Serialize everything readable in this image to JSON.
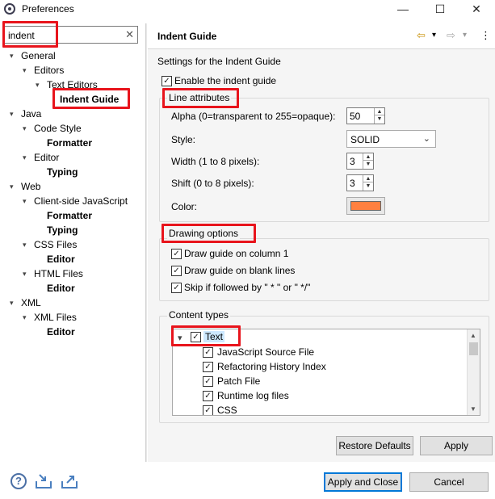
{
  "window": {
    "title": "Preferences",
    "min": "—",
    "max": "☐",
    "close": "✕"
  },
  "search": {
    "value": "indent",
    "clear": "✕"
  },
  "tree": [
    {
      "label": "General",
      "bold": false,
      "twisty": "▾"
    },
    {
      "label": "Editors",
      "bold": false,
      "twisty": "▾"
    },
    {
      "label": "Text Editors",
      "bold": false,
      "twisty": "▾"
    },
    {
      "label": "Indent Guide",
      "bold": true,
      "twisty": ""
    },
    {
      "label": "Java",
      "bold": false,
      "twisty": "▾"
    },
    {
      "label": "Code Style",
      "bold": false,
      "twisty": "▾"
    },
    {
      "label": "Formatter",
      "bold": true,
      "twisty": ""
    },
    {
      "label": "Editor",
      "bold": false,
      "twisty": "▾"
    },
    {
      "label": "Typing",
      "bold": true,
      "twisty": ""
    },
    {
      "label": "Web",
      "bold": false,
      "twisty": "▾"
    },
    {
      "label": "Client-side JavaScript",
      "bold": false,
      "twisty": "▾"
    },
    {
      "label": "Formatter",
      "bold": true,
      "twisty": ""
    },
    {
      "label": "Typing",
      "bold": true,
      "twisty": ""
    },
    {
      "label": "CSS Files",
      "bold": false,
      "twisty": "▾"
    },
    {
      "label": "Editor",
      "bold": true,
      "twisty": ""
    },
    {
      "label": "HTML Files",
      "bold": false,
      "twisty": "▾"
    },
    {
      "label": "Editor",
      "bold": true,
      "twisty": ""
    },
    {
      "label": "XML",
      "bold": false,
      "twisty": "▾"
    },
    {
      "label": "XML Files",
      "bold": false,
      "twisty": "▾"
    },
    {
      "label": "Editor",
      "bold": true,
      "twisty": ""
    }
  ],
  "page": {
    "title": "Indent Guide",
    "description": "Settings for the Indent Guide",
    "enable_label": "Enable the indent guide",
    "enable_checked": true,
    "nav_back": "⇦",
    "nav_forward": "⇨",
    "nav_menu": "▾",
    "view_menu": "⋮"
  },
  "line_attributes": {
    "group_title": "Line attributes",
    "alpha_label": "Alpha (0=transparent to 255=opaque):",
    "alpha_value": "50",
    "style_label": "Style:",
    "style_value": "SOLID",
    "width_label": "Width (1 to 8 pixels):",
    "width_value": "3",
    "shift_label": "Shift (0 to 8 pixels):",
    "shift_value": "3",
    "color_label": "Color:",
    "color_value": "#ff8040"
  },
  "drawing_options": {
    "group_title": "Drawing options",
    "items": [
      {
        "label": "Draw guide on column 1",
        "checked": true
      },
      {
        "label": "Draw guide on blank lines",
        "checked": true
      },
      {
        "label": "Skip if followed by \" * \" or \" */\"",
        "checked": true
      }
    ]
  },
  "content_types": {
    "group_title": "Content types",
    "root": {
      "label": "Text",
      "checked": true,
      "twisty": "▾"
    },
    "children": [
      {
        "label": "JavaScript Source File",
        "checked": true
      },
      {
        "label": "Refactoring History Index",
        "checked": true
      },
      {
        "label": "Patch File",
        "checked": true
      },
      {
        "label": "Runtime log files",
        "checked": true
      },
      {
        "label": "CSS",
        "checked": true
      }
    ]
  },
  "buttons": {
    "restore_defaults": "Restore Defaults",
    "apply": "Apply",
    "apply_and_close": "Apply and Close",
    "cancel": "Cancel"
  },
  "icons": {
    "help": "?",
    "highlight_color": "#e8141c",
    "accent_color": "#0078d7"
  }
}
